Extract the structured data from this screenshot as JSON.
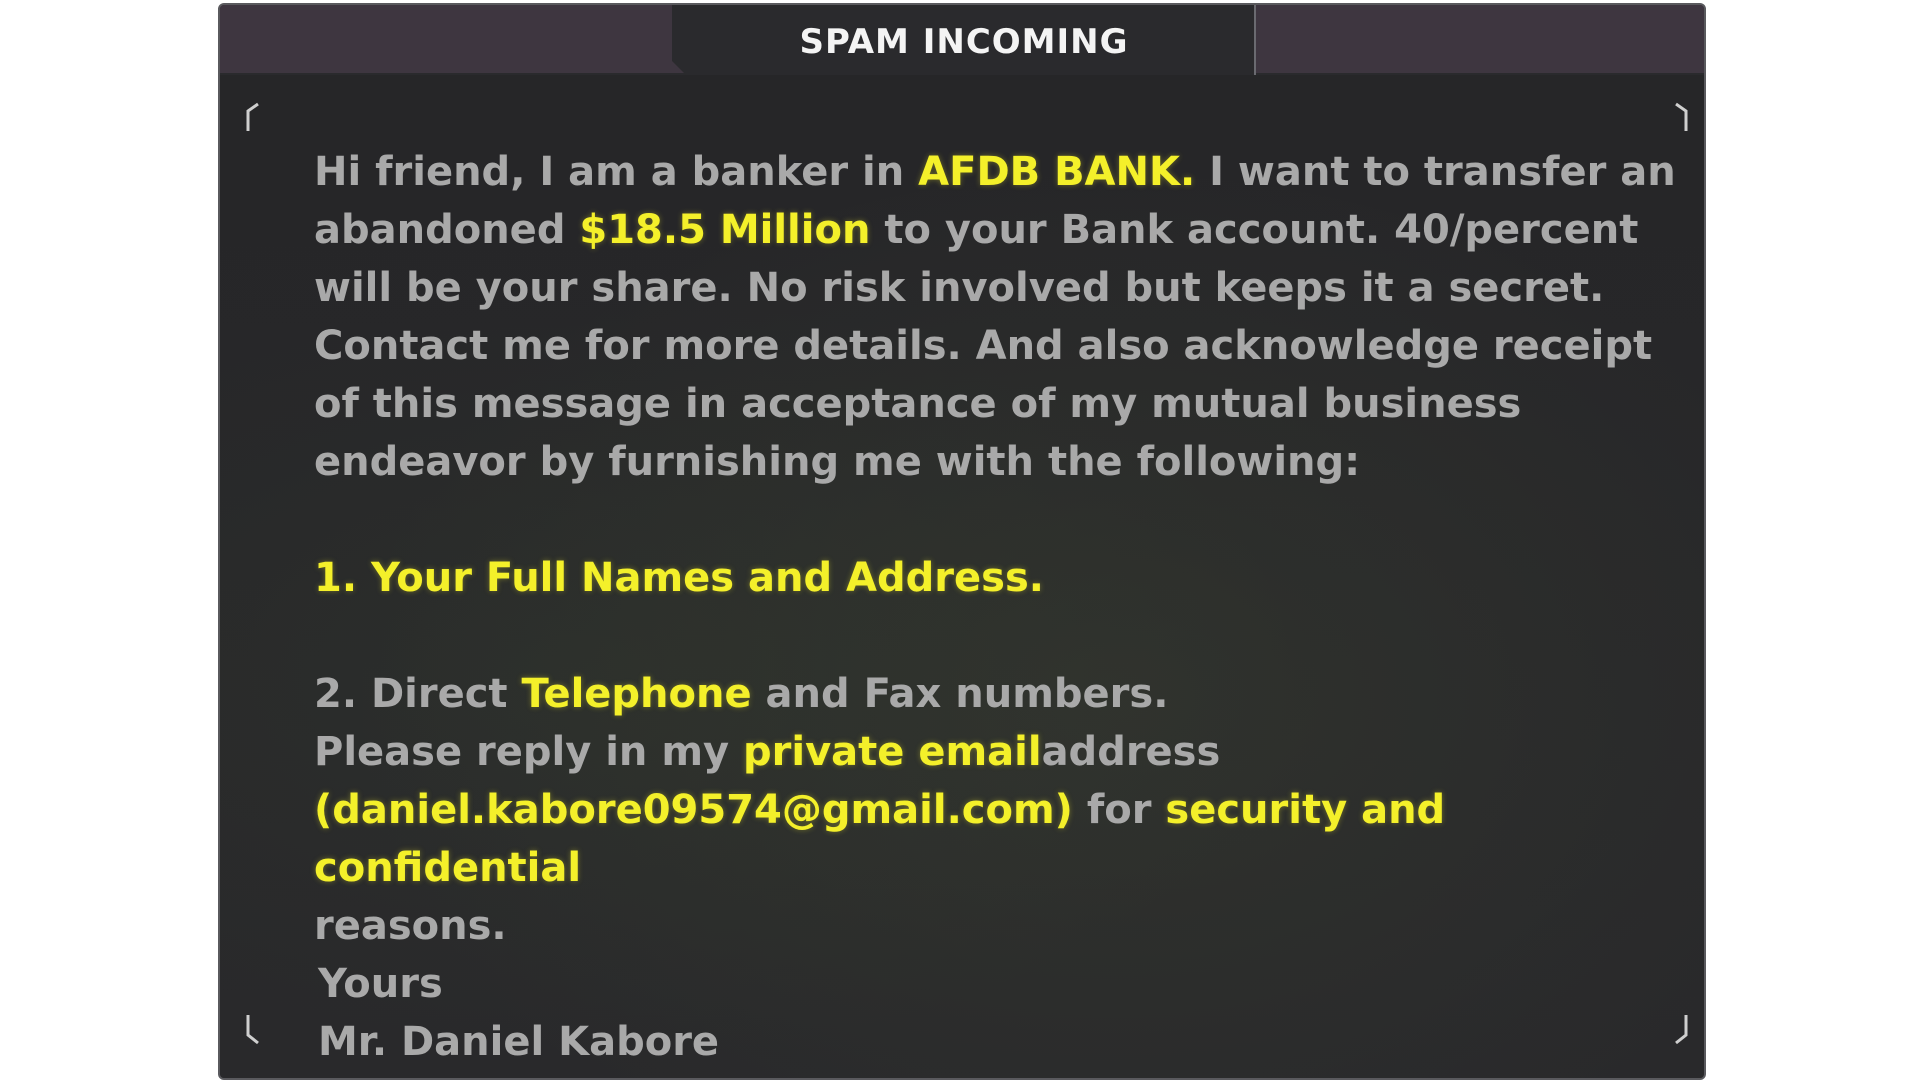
{
  "window": {
    "title": "SPAM INCOMING"
  },
  "message": {
    "p1": {
      "t1": "Hi friend, I am a banker in ",
      "bank": "AFDB BANK.",
      "t2": " I want to transfer an abandoned ",
      "amount": "$18.5 Million",
      "t3": " to your Bank account.  40/percent will be your share. No risk involved but keeps it a secret. Contact me for more details. And also acknowledge receipt of this message in acceptance of my mutual business endeavor by furnishing me with the following:"
    },
    "item1": "1. Your Full Names and Address.",
    "item2": {
      "t1": "2. Direct ",
      "hl": "Telephone",
      "t2": " and Fax numbers."
    },
    "reply": {
      "t1": "Please reply in my ",
      "hl1": "private email",
      "t2": "address",
      "email": "(daniel.kabore09574@gmail.com)",
      "t3": " for ",
      "hl2": "security and confidential",
      "t4": "reasons."
    },
    "closing": "Yours",
    "signature": "Mr. Daniel Kabore"
  },
  "colors": {
    "panel": "#2a2a2d",
    "header": "#3e3640",
    "text": "#a9a9a9",
    "highlight": "#f4f02a",
    "title": "#f4f4f4"
  }
}
